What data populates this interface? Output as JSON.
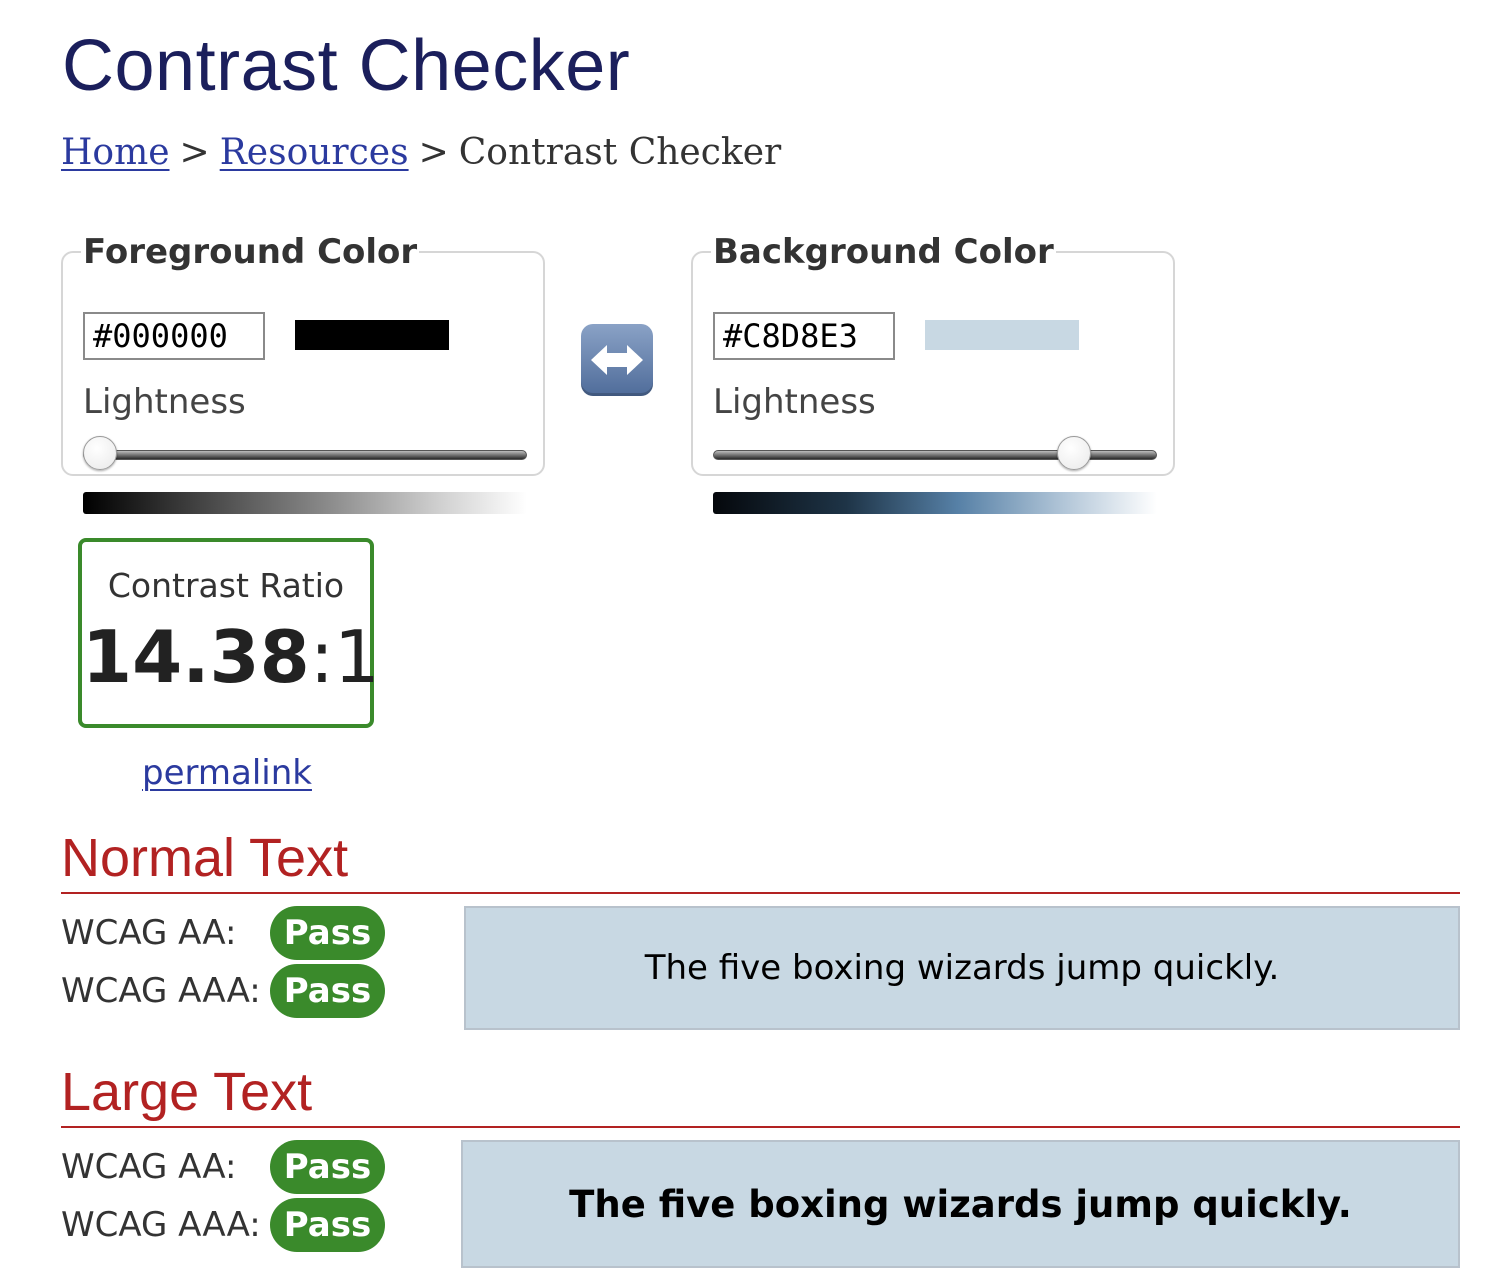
{
  "page": {
    "title": "Contrast Checker"
  },
  "breadcrumb": {
    "home": "Home",
    "sep1": ">",
    "resources": "Resources",
    "sep2": ">",
    "current": "Contrast Checker"
  },
  "foreground": {
    "legend": "Foreground Color",
    "hex_value": "#000000",
    "swatch_color": "#000000",
    "lightness_label": "Lightness",
    "lightness_percent": 0
  },
  "swap": {
    "icon": "left-right-arrow-icon"
  },
  "background": {
    "legend": "Background Color",
    "hex_value": "#C8D8E3",
    "swatch_color": "#C8D8E3",
    "lightness_label": "Lightness",
    "lightness_percent": 84
  },
  "contrast": {
    "label": "Contrast Ratio",
    "value": "14.38",
    "suffix": ":1"
  },
  "permalink": "permalink",
  "normal_text": {
    "heading": "Normal Text",
    "aa_label": "WCAG AA:",
    "aa_result": "Pass",
    "aaa_label": "WCAG AAA:",
    "aaa_result": "Pass",
    "sample": "The five boxing wizards jump quickly."
  },
  "large_text": {
    "heading": "Large Text",
    "aa_label": "WCAG AA:",
    "aa_result": "Pass",
    "aaa_label": "WCAG AAA:",
    "aaa_result": "Pass",
    "sample": "The five boxing wizards jump quickly."
  },
  "colors": {
    "title": "#1b1f5c",
    "link": "#2b3a9f",
    "section_heading": "#b22222",
    "pass": "#3a8a2b",
    "sample_background": "#C8D8E3",
    "sample_text": "#000000"
  }
}
